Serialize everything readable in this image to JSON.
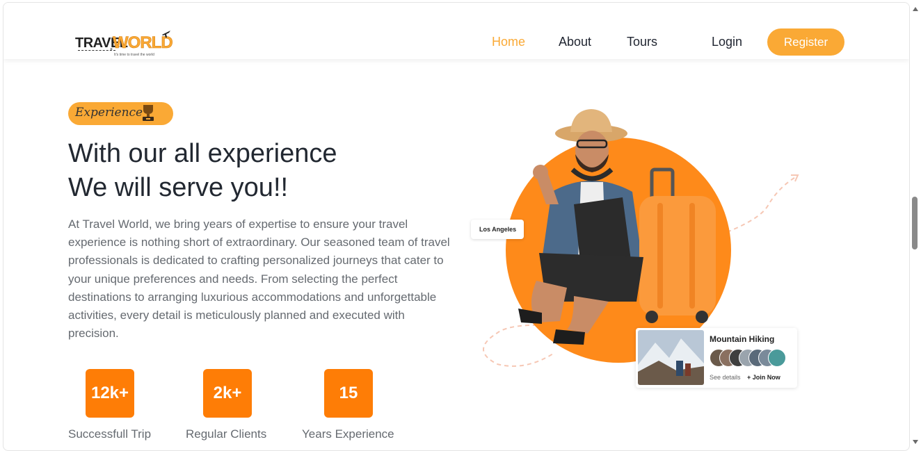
{
  "brand": {
    "logo_word1": "TRAVEL",
    "logo_word2": "WORLD",
    "logo_tagline": "It's time to travel the world"
  },
  "nav": {
    "items": [
      {
        "label": "Home",
        "active": true
      },
      {
        "label": "About",
        "active": false
      },
      {
        "label": "Tours",
        "active": false
      }
    ],
    "login_label": "Login",
    "register_label": "Register"
  },
  "hero": {
    "badge_text": "Experience",
    "headline_line1": "With our all experience",
    "headline_line2": "We will serve you!!",
    "description": "At Travel World, we bring years of expertise to ensure your travel experience is nothing short of extraordinary. Our seasoned team of travel professionals is dedicated to crafting personalized journeys that cater to your unique preferences and needs. From selecting the perfect destinations to arranging luxurious accommodations and unforgettable activities, every detail is meticulously planned and executed with precision."
  },
  "stats": [
    {
      "value": "12k+",
      "label": "Successfull Trip"
    },
    {
      "value": "2k+",
      "label": "Regular Clients"
    },
    {
      "value": "15",
      "label": "Years Experience"
    }
  ],
  "illustration": {
    "city_tag": "Los Angeles",
    "card_title": "Mountain Hiking",
    "card_link_details": "See details",
    "card_link_join": "+ Join Now"
  },
  "colors": {
    "accent": "#faa935",
    "stat_bg": "#fe7d06",
    "heading": "#222831",
    "body_text": "#656a70"
  }
}
